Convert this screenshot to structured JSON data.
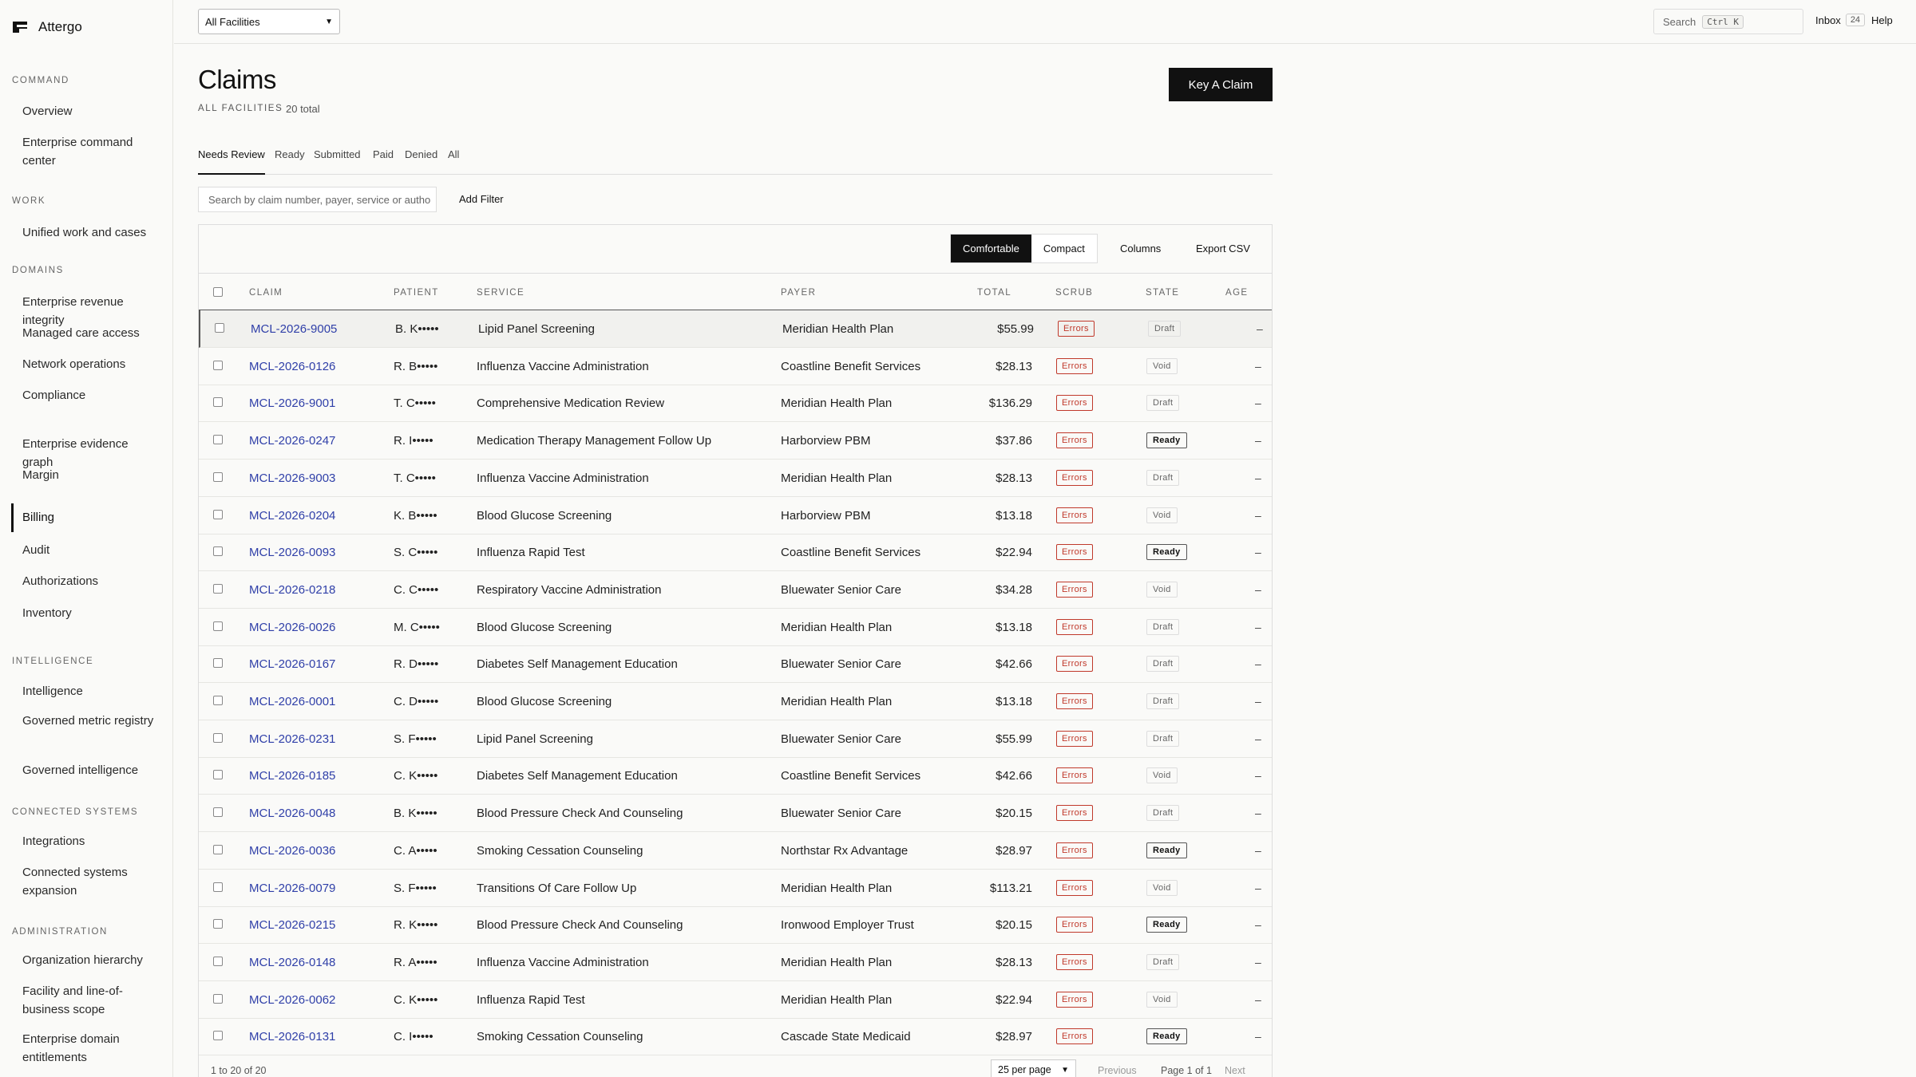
{
  "brand": {
    "name": "Attergo"
  },
  "sidebar": {
    "sections": [
      {
        "title": "COMMAND",
        "items": [
          {
            "label": "Overview"
          },
          {
            "label": "Enterprise command center"
          }
        ]
      },
      {
        "title": "WORK",
        "items": [
          {
            "label": "Unified work and cases"
          }
        ]
      },
      {
        "title": "DOMAINS",
        "items": [
          {
            "label": "Enterprise revenue integrity"
          },
          {
            "label": "Managed care access"
          },
          {
            "label": "Network operations"
          },
          {
            "label": "Compliance"
          },
          {
            "label": "Enterprise evidence graph"
          },
          {
            "label": "Margin"
          },
          {
            "label": "Billing"
          },
          {
            "label": "Audit"
          },
          {
            "label": "Authorizations"
          },
          {
            "label": "Inventory"
          }
        ]
      },
      {
        "title": "INTELLIGENCE",
        "items": [
          {
            "label": "Intelligence"
          },
          {
            "label": "Governed metric registry"
          },
          {
            "label": "Governed intelligence"
          }
        ]
      },
      {
        "title": "CONNECTED SYSTEMS",
        "items": [
          {
            "label": "Integrations"
          },
          {
            "label": "Connected systems expansion"
          }
        ]
      },
      {
        "title": "ADMINISTRATION",
        "items": [
          {
            "label": "Organization hierarchy"
          },
          {
            "label": "Facility and line-of-business scope"
          },
          {
            "label": "Enterprise domain entitlements"
          }
        ]
      }
    ],
    "active": "Billing"
  },
  "topbar": {
    "facility": "All Facilities",
    "search_label": "Search",
    "search_shortcut": "Ctrl K",
    "inbox_label": "Inbox",
    "inbox_count": "24",
    "help_label": "Help"
  },
  "page": {
    "title": "Claims",
    "scope": "ALL FACILITIES",
    "count": "20 total",
    "primary_action": "Key A Claim"
  },
  "tabs": [
    "Needs Review",
    "Ready",
    "Submitted",
    "Paid",
    "Denied",
    "All"
  ],
  "active_tab": "Needs Review",
  "filters": {
    "search_placeholder": "Search by claim number, payer, service or autho",
    "add_filter": "Add Filter"
  },
  "toolbar": {
    "density_options": [
      "Comfortable",
      "Compact"
    ],
    "density_selected": "Comfortable",
    "columns": "Columns",
    "export": "Export CSV"
  },
  "table": {
    "columns": [
      "CLAIM",
      "PATIENT",
      "SERVICE",
      "PAYER",
      "TOTAL",
      "SCRUB",
      "STATE",
      "AGE"
    ],
    "rows": [
      {
        "claim": "MCL-2026-9005",
        "patient": "B. K•••••",
        "service": "Lipid Panel Screening",
        "payer": "Meridian Health Plan",
        "total": "$55.99",
        "scrub": "Errors",
        "state": "Draft",
        "age": "–"
      },
      {
        "claim": "MCL-2026-0126",
        "patient": "R. B•••••",
        "service": "Influenza Vaccine Administration",
        "payer": "Coastline Benefit Services",
        "total": "$28.13",
        "scrub": "Errors",
        "state": "Void",
        "age": "–"
      },
      {
        "claim": "MCL-2026-9001",
        "patient": "T. C•••••",
        "service": "Comprehensive Medication Review",
        "payer": "Meridian Health Plan",
        "total": "$136.29",
        "scrub": "Errors",
        "state": "Draft",
        "age": "–"
      },
      {
        "claim": "MCL-2026-0247",
        "patient": "R. I•••••",
        "service": "Medication Therapy Management Follow Up",
        "payer": "Harborview PBM",
        "total": "$37.86",
        "scrub": "Errors",
        "state": "Ready",
        "age": "–"
      },
      {
        "claim": "MCL-2026-9003",
        "patient": "T. C•••••",
        "service": "Influenza Vaccine Administration",
        "payer": "Meridian Health Plan",
        "total": "$28.13",
        "scrub": "Errors",
        "state": "Draft",
        "age": "–"
      },
      {
        "claim": "MCL-2026-0204",
        "patient": "K. B•••••",
        "service": "Blood Glucose Screening",
        "payer": "Harborview PBM",
        "total": "$13.18",
        "scrub": "Errors",
        "state": "Void",
        "age": "–"
      },
      {
        "claim": "MCL-2026-0093",
        "patient": "S. C•••••",
        "service": "Influenza Rapid Test",
        "payer": "Coastline Benefit Services",
        "total": "$22.94",
        "scrub": "Errors",
        "state": "Ready",
        "age": "–"
      },
      {
        "claim": "MCL-2026-0218",
        "patient": "C. C•••••",
        "service": "Respiratory Vaccine Administration",
        "payer": "Bluewater Senior Care",
        "total": "$34.28",
        "scrub": "Errors",
        "state": "Void",
        "age": "–"
      },
      {
        "claim": "MCL-2026-0026",
        "patient": "M. C•••••",
        "service": "Blood Glucose Screening",
        "payer": "Meridian Health Plan",
        "total": "$13.18",
        "scrub": "Errors",
        "state": "Draft",
        "age": "–"
      },
      {
        "claim": "MCL-2026-0167",
        "patient": "R. D•••••",
        "service": "Diabetes Self Management Education",
        "payer": "Bluewater Senior Care",
        "total": "$42.66",
        "scrub": "Errors",
        "state": "Draft",
        "age": "–"
      },
      {
        "claim": "MCL-2026-0001",
        "patient": "C. D•••••",
        "service": "Blood Glucose Screening",
        "payer": "Meridian Health Plan",
        "total": "$13.18",
        "scrub": "Errors",
        "state": "Draft",
        "age": "–"
      },
      {
        "claim": "MCL-2026-0231",
        "patient": "S. F•••••",
        "service": "Lipid Panel Screening",
        "payer": "Bluewater Senior Care",
        "total": "$55.99",
        "scrub": "Errors",
        "state": "Draft",
        "age": "–"
      },
      {
        "claim": "MCL-2026-0185",
        "patient": "C. K•••••",
        "service": "Diabetes Self Management Education",
        "payer": "Coastline Benefit Services",
        "total": "$42.66",
        "scrub": "Errors",
        "state": "Void",
        "age": "–"
      },
      {
        "claim": "MCL-2026-0048",
        "patient": "B. K•••••",
        "service": "Blood Pressure Check And Counseling",
        "payer": "Bluewater Senior Care",
        "total": "$20.15",
        "scrub": "Errors",
        "state": "Draft",
        "age": "–"
      },
      {
        "claim": "MCL-2026-0036",
        "patient": "C. A•••••",
        "service": "Smoking Cessation Counseling",
        "payer": "Northstar Rx Advantage",
        "total": "$28.97",
        "scrub": "Errors",
        "state": "Ready",
        "age": "–"
      },
      {
        "claim": "MCL-2026-0079",
        "patient": "S. F•••••",
        "service": "Transitions Of Care Follow Up",
        "payer": "Meridian Health Plan",
        "total": "$113.21",
        "scrub": "Errors",
        "state": "Void",
        "age": "–"
      },
      {
        "claim": "MCL-2026-0215",
        "patient": "R. K•••••",
        "service": "Blood Pressure Check And Counseling",
        "payer": "Ironwood Employer Trust",
        "total": "$20.15",
        "scrub": "Errors",
        "state": "Ready",
        "age": "–"
      },
      {
        "claim": "MCL-2026-0148",
        "patient": "R. A•••••",
        "service": "Influenza Vaccine Administration",
        "payer": "Meridian Health Plan",
        "total": "$28.13",
        "scrub": "Errors",
        "state": "Draft",
        "age": "–"
      },
      {
        "claim": "MCL-2026-0062",
        "patient": "C. K•••••",
        "service": "Influenza Rapid Test",
        "payer": "Meridian Health Plan",
        "total": "$22.94",
        "scrub": "Errors",
        "state": "Void",
        "age": "–"
      },
      {
        "claim": "MCL-2026-0131",
        "patient": "C. I•••••",
        "service": "Smoking Cessation Counseling",
        "payer": "Cascade State Medicaid",
        "total": "$28.97",
        "scrub": "Errors",
        "state": "Ready",
        "age": "–"
      }
    ]
  },
  "pagination": {
    "range": "1 to 20 of 20",
    "per_page": "25 per page",
    "previous": "Previous",
    "page_info": "Page 1 of 1",
    "next": "Next"
  },
  "colors": {
    "link": "#2f3fa8",
    "error": "#c0392b",
    "primary": "#111111"
  }
}
